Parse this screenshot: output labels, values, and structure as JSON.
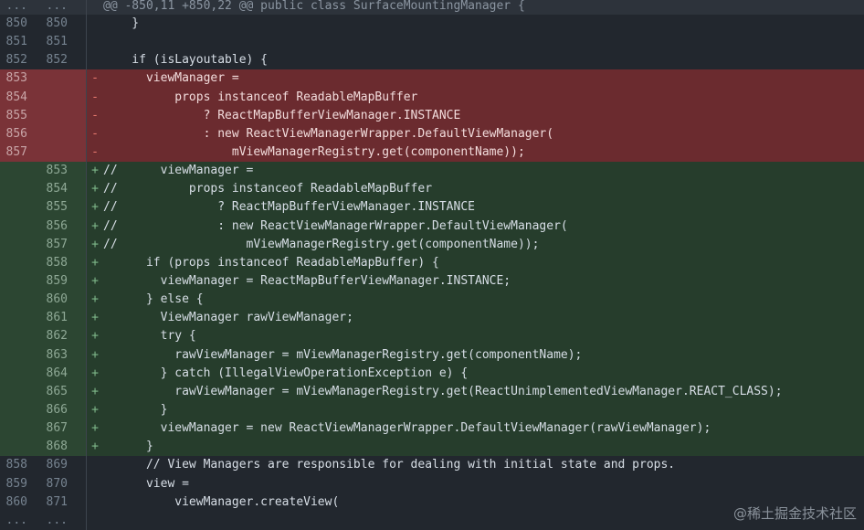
{
  "hunk": {
    "old_ln": "...",
    "new_ln": "...",
    "header": "@@ -850,11 +850,22 @@ public class SurfaceMountingManager {"
  },
  "lines": [
    {
      "type": "ctx",
      "old": "850",
      "new": "850",
      "sign": " ",
      "text": "    }"
    },
    {
      "type": "ctx",
      "old": "851",
      "new": "851",
      "sign": " ",
      "text": ""
    },
    {
      "type": "ctx",
      "old": "852",
      "new": "852",
      "sign": " ",
      "text": "    if (isLayoutable) {"
    },
    {
      "type": "del",
      "old": "853",
      "new": "",
      "sign": "-",
      "text": "      viewManager ="
    },
    {
      "type": "del",
      "old": "854",
      "new": "",
      "sign": "-",
      "text": "          props instanceof ReadableMapBuffer"
    },
    {
      "type": "del",
      "old": "855",
      "new": "",
      "sign": "-",
      "text": "              ? ReactMapBufferViewManager.INSTANCE"
    },
    {
      "type": "del",
      "old": "856",
      "new": "",
      "sign": "-",
      "text": "              : new ReactViewManagerWrapper.DefaultViewManager("
    },
    {
      "type": "del",
      "old": "857",
      "new": "",
      "sign": "-",
      "text": "                  mViewManagerRegistry.get(componentName));"
    },
    {
      "type": "add",
      "old": "",
      "new": "853",
      "sign": "+",
      "text": "//      viewManager ="
    },
    {
      "type": "add",
      "old": "",
      "new": "854",
      "sign": "+",
      "text": "//          props instanceof ReadableMapBuffer"
    },
    {
      "type": "add",
      "old": "",
      "new": "855",
      "sign": "+",
      "text": "//              ? ReactMapBufferViewManager.INSTANCE"
    },
    {
      "type": "add",
      "old": "",
      "new": "856",
      "sign": "+",
      "text": "//              : new ReactViewManagerWrapper.DefaultViewManager("
    },
    {
      "type": "add",
      "old": "",
      "new": "857",
      "sign": "+",
      "text": "//                  mViewManagerRegistry.get(componentName));"
    },
    {
      "type": "add",
      "old": "",
      "new": "858",
      "sign": "+",
      "text": "      if (props instanceof ReadableMapBuffer) {"
    },
    {
      "type": "add",
      "old": "",
      "new": "859",
      "sign": "+",
      "text": "        viewManager = ReactMapBufferViewManager.INSTANCE;"
    },
    {
      "type": "add",
      "old": "",
      "new": "860",
      "sign": "+",
      "text": "      } else {"
    },
    {
      "type": "add",
      "old": "",
      "new": "861",
      "sign": "+",
      "text": "        ViewManager rawViewManager;"
    },
    {
      "type": "add",
      "old": "",
      "new": "862",
      "sign": "+",
      "text": "        try {"
    },
    {
      "type": "add",
      "old": "",
      "new": "863",
      "sign": "+",
      "text": "          rawViewManager = mViewManagerRegistry.get(componentName);"
    },
    {
      "type": "add",
      "old": "",
      "new": "864",
      "sign": "+",
      "text": "        } catch (IllegalViewOperationException e) {"
    },
    {
      "type": "add",
      "old": "",
      "new": "865",
      "sign": "+",
      "text": "          rawViewManager = mViewManagerRegistry.get(ReactUnimplementedViewManager.REACT_CLASS);"
    },
    {
      "type": "add",
      "old": "",
      "new": "866",
      "sign": "+",
      "text": "        }"
    },
    {
      "type": "add",
      "old": "",
      "new": "867",
      "sign": "+",
      "text": "        viewManager = new ReactViewManagerWrapper.DefaultViewManager(rawViewManager);"
    },
    {
      "type": "add",
      "old": "",
      "new": "868",
      "sign": "+",
      "text": "      }"
    },
    {
      "type": "ctx",
      "old": "858",
      "new": "869",
      "sign": " ",
      "text": "      // View Managers are responsible for dealing with initial state and props."
    },
    {
      "type": "ctx",
      "old": "859",
      "new": "870",
      "sign": " ",
      "text": "      view ="
    },
    {
      "type": "ctx",
      "old": "860",
      "new": "871",
      "sign": " ",
      "text": "          viewManager.createView("
    },
    {
      "type": "ctx",
      "old": "...",
      "new": "...",
      "sign": " ",
      "text": ""
    }
  ],
  "watermark": "@稀土掘金技术社区"
}
